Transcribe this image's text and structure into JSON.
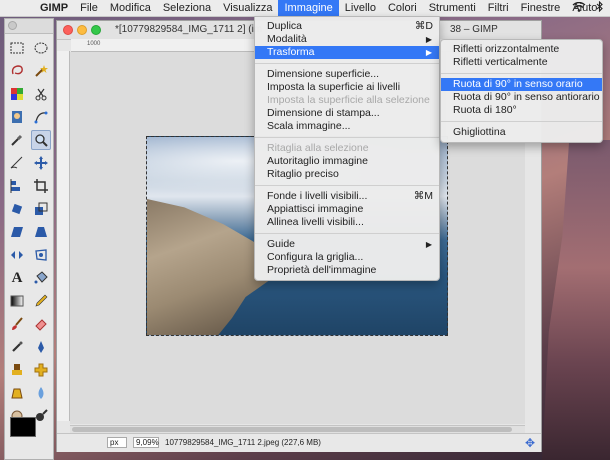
{
  "menubar": {
    "app_name": "GIMP",
    "items": [
      "File",
      "Modifica",
      "Seleziona",
      "Visualizza",
      "Immagine",
      "Livello",
      "Colori",
      "Strumenti",
      "Filtri",
      "Finestre",
      "Aiuto"
    ],
    "active": "Immagine"
  },
  "window": {
    "title_left": "*[10779829584_IMG_1711 2] (im",
    "title_right": "38 – GIMP",
    "ruler_labels": [
      "1000",
      "1000",
      "1000"
    ]
  },
  "statusbar": {
    "unit": "px",
    "zoom": "9,09%",
    "file_info": "10779829584_IMG_1711 2.jpeg (227,6 MB)"
  },
  "image_menu": {
    "items": [
      {
        "label": "Duplica",
        "shortcut": "⌘D",
        "state": "normal"
      },
      {
        "label": "Modalità",
        "arrow": "▶",
        "state": "normal"
      },
      {
        "label": "Trasforma",
        "arrow": "▶",
        "state": "highlight"
      },
      {
        "sep": true
      },
      {
        "label": "Dimensione superficie...",
        "state": "normal"
      },
      {
        "label": "Imposta la superficie ai livelli",
        "state": "normal"
      },
      {
        "label": "Imposta la superficie alla selezione",
        "state": "disabled"
      },
      {
        "label": "Dimensione di stampa...",
        "state": "normal"
      },
      {
        "label": "Scala immagine...",
        "state": "normal"
      },
      {
        "sep": true
      },
      {
        "label": "Ritaglia alla selezione",
        "state": "disabled"
      },
      {
        "label": "Autoritaglio immagine",
        "state": "normal"
      },
      {
        "label": "Ritaglio preciso",
        "state": "normal"
      },
      {
        "sep": true
      },
      {
        "label": "Fonde i livelli visibili...",
        "shortcut": "⌘M",
        "state": "normal"
      },
      {
        "label": "Appiattisci immagine",
        "state": "normal"
      },
      {
        "label": "Allinea livelli visibili...",
        "state": "normal"
      },
      {
        "sep": true
      },
      {
        "label": "Guide",
        "arrow": "▶",
        "state": "normal"
      },
      {
        "label": "Configura la griglia...",
        "state": "normal"
      },
      {
        "label": "Proprietà dell'immagine",
        "state": "normal"
      }
    ]
  },
  "transform_submenu": {
    "items": [
      {
        "label": "Rifletti orizzontalmente",
        "state": "normal"
      },
      {
        "label": "Rifletti verticalmente",
        "state": "normal"
      },
      {
        "sep": true
      },
      {
        "label": "Ruota di 90° in senso orario",
        "state": "highlight"
      },
      {
        "label": "Ruota di 90° in senso antiorario",
        "state": "normal"
      },
      {
        "label": "Ruota di 180°",
        "state": "normal"
      },
      {
        "sep": true
      },
      {
        "label": "Ghigliottina",
        "state": "normal"
      }
    ]
  },
  "colors": {
    "accent": "#3478f6",
    "fg": "#000000",
    "bg": "#ffffff"
  },
  "tools": [
    "rect-select-icon",
    "ellipse-select-icon",
    "lasso-icon",
    "fuzzy-select-icon",
    "color-select-icon",
    "scissors-icon",
    "foreground-select-icon",
    "paths-icon",
    "color-picker-icon",
    "zoom-icon",
    "measure-icon",
    "move-icon",
    "align-icon",
    "crop-icon",
    "rotate-icon",
    "scale-icon",
    "shear-icon",
    "perspective-icon",
    "flip-icon",
    "cage-icon",
    "text-icon",
    "bucket-fill-icon",
    "blend-icon",
    "pencil-icon",
    "paintbrush-icon",
    "eraser-icon",
    "airbrush-icon",
    "ink-icon",
    "clone-icon",
    "heal-icon",
    "perspective-clone-icon",
    "blur-icon",
    "smudge-icon",
    "dodge-icon"
  ]
}
